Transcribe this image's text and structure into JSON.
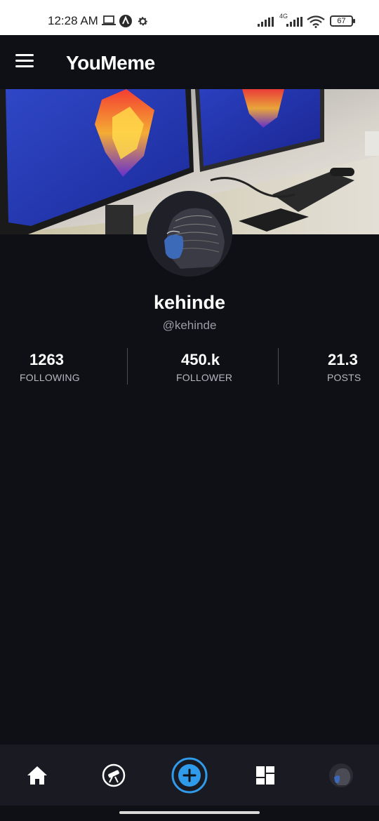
{
  "status_bar": {
    "time": "12:28 AM",
    "network": "4G",
    "battery": "67",
    "icons": [
      "laptop-icon",
      "app-notification-icon",
      "settings-icon",
      "signal-icon",
      "signal-4g-icon",
      "wifi-icon",
      "battery-icon"
    ]
  },
  "header": {
    "title": "YouMeme",
    "menu_icon": "hamburger-menu-icon"
  },
  "profile": {
    "name": "kehinde",
    "handle": "@kehinde",
    "stats": [
      {
        "value": "1263",
        "label": "FOLLOWING"
      },
      {
        "value": "450.k",
        "label": "FOLLOWER"
      },
      {
        "value": "21.3",
        "label": "POSTS"
      }
    ]
  },
  "bottom_nav": {
    "items": [
      "home-icon",
      "explore-telescope-icon",
      "add-post-icon",
      "dashboard-grid-icon",
      "profile-avatar-icon"
    ],
    "accent_color": "#2f9bea"
  },
  "colors": {
    "background": "#0f1016",
    "nav_background": "#1a1b22",
    "accent": "#2f9bea"
  }
}
